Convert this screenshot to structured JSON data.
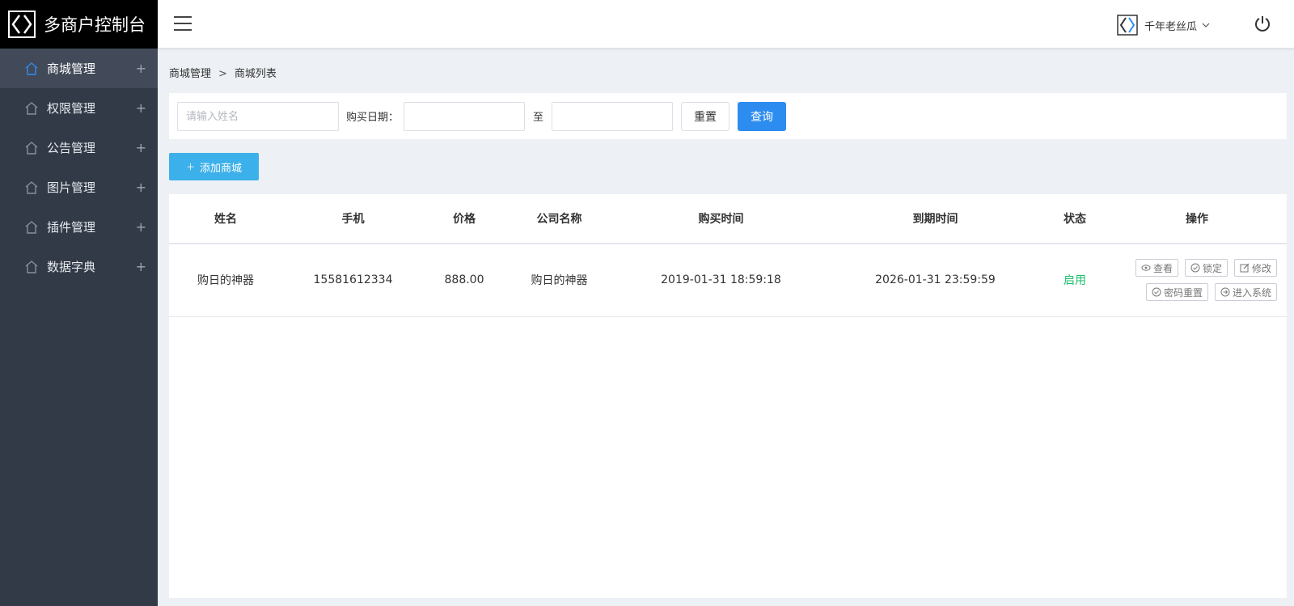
{
  "brand": {
    "title": "多商户控制台"
  },
  "sidebar": {
    "items": [
      {
        "label": "商城管理",
        "icon": "home-icon",
        "active": true
      },
      {
        "label": "权限管理",
        "icon": "home-icon",
        "active": false
      },
      {
        "label": "公告管理",
        "icon": "home-icon",
        "active": false
      },
      {
        "label": "图片管理",
        "icon": "home-icon",
        "active": false
      },
      {
        "label": "插件管理",
        "icon": "home-icon",
        "active": false
      },
      {
        "label": "数据字典",
        "icon": "home-icon",
        "active": false
      }
    ],
    "expand_symbol": "+"
  },
  "header": {
    "menu_icon": "hamburger-icon",
    "user_name": "千年老丝瓜",
    "power_icon": "power-icon"
  },
  "breadcrumb": {
    "parent": "商城管理",
    "separator": ">",
    "current": "商城列表"
  },
  "filter": {
    "name_placeholder": "请输入姓名",
    "date_label": "购买日期：",
    "range_sep": "至",
    "start_value": "",
    "end_value": "",
    "reset_label": "重置",
    "query_label": "查询"
  },
  "add_button": {
    "icon": "plus-icon",
    "label": "添加商城"
  },
  "table": {
    "columns": [
      "姓名",
      "手机",
      "价格",
      "公司名称",
      "购买时间",
      "到期时间",
      "状态",
      "操作"
    ],
    "rows": [
      {
        "name": "购日的神器",
        "phone": "15581612334",
        "price": "888.00",
        "company": "购日的神器",
        "buy_time": "2019-01-31 18:59:18",
        "expire_time": "2026-01-31 23:59:59",
        "status": "启用",
        "actions": {
          "view": "查看",
          "lock": "锁定",
          "edit": "修改",
          "reset_pwd": "密码重置",
          "enter": "进入系统"
        }
      }
    ]
  },
  "colors": {
    "accent": "#2d8cf0",
    "add": "#3cb0ea",
    "sidebar": "#323a48",
    "status_on": "#19be6b"
  }
}
